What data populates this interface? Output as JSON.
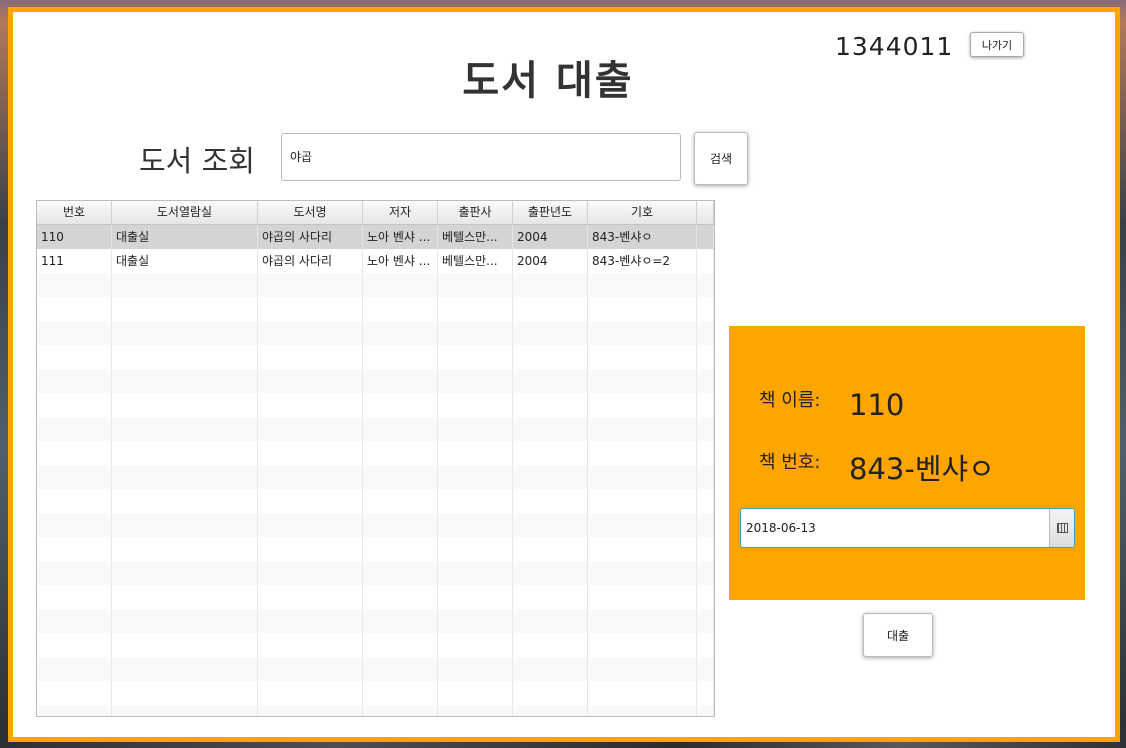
{
  "title": "도서 대출",
  "user_id": "1344011",
  "logout_label": "나가기",
  "search": {
    "label": "도서 조회",
    "value": "야곱",
    "button_label": "검색"
  },
  "table": {
    "columns": [
      "번호",
      "도서열람실",
      "도서명",
      "저자",
      "출판사",
      "출판년도",
      "기호"
    ],
    "rows": [
      [
        "110",
        "대출실",
        "야곱의 사다리",
        "노아 벤샤 ...",
        "베텔스만...",
        "2004",
        "843-벤샤ㅇ"
      ],
      [
        "111",
        "대출실",
        "야곱의 사다리",
        "노아 벤샤 ...",
        "베텔스만...",
        "2004",
        "843-벤샤ㅇ=2"
      ]
    ]
  },
  "detail": {
    "name_label": "책 이름:",
    "name_value": "110",
    "number_label": "책 번호:",
    "number_value": "843-벤샤ㅇ",
    "date_value": "2018-06-13"
  },
  "borrow_label": "대출",
  "colors": {
    "frame": "#ffa500",
    "panel": "#ffa500",
    "date_focus": "#2aa8c4"
  },
  "icons": {
    "date_picker": "calendar-icon"
  }
}
